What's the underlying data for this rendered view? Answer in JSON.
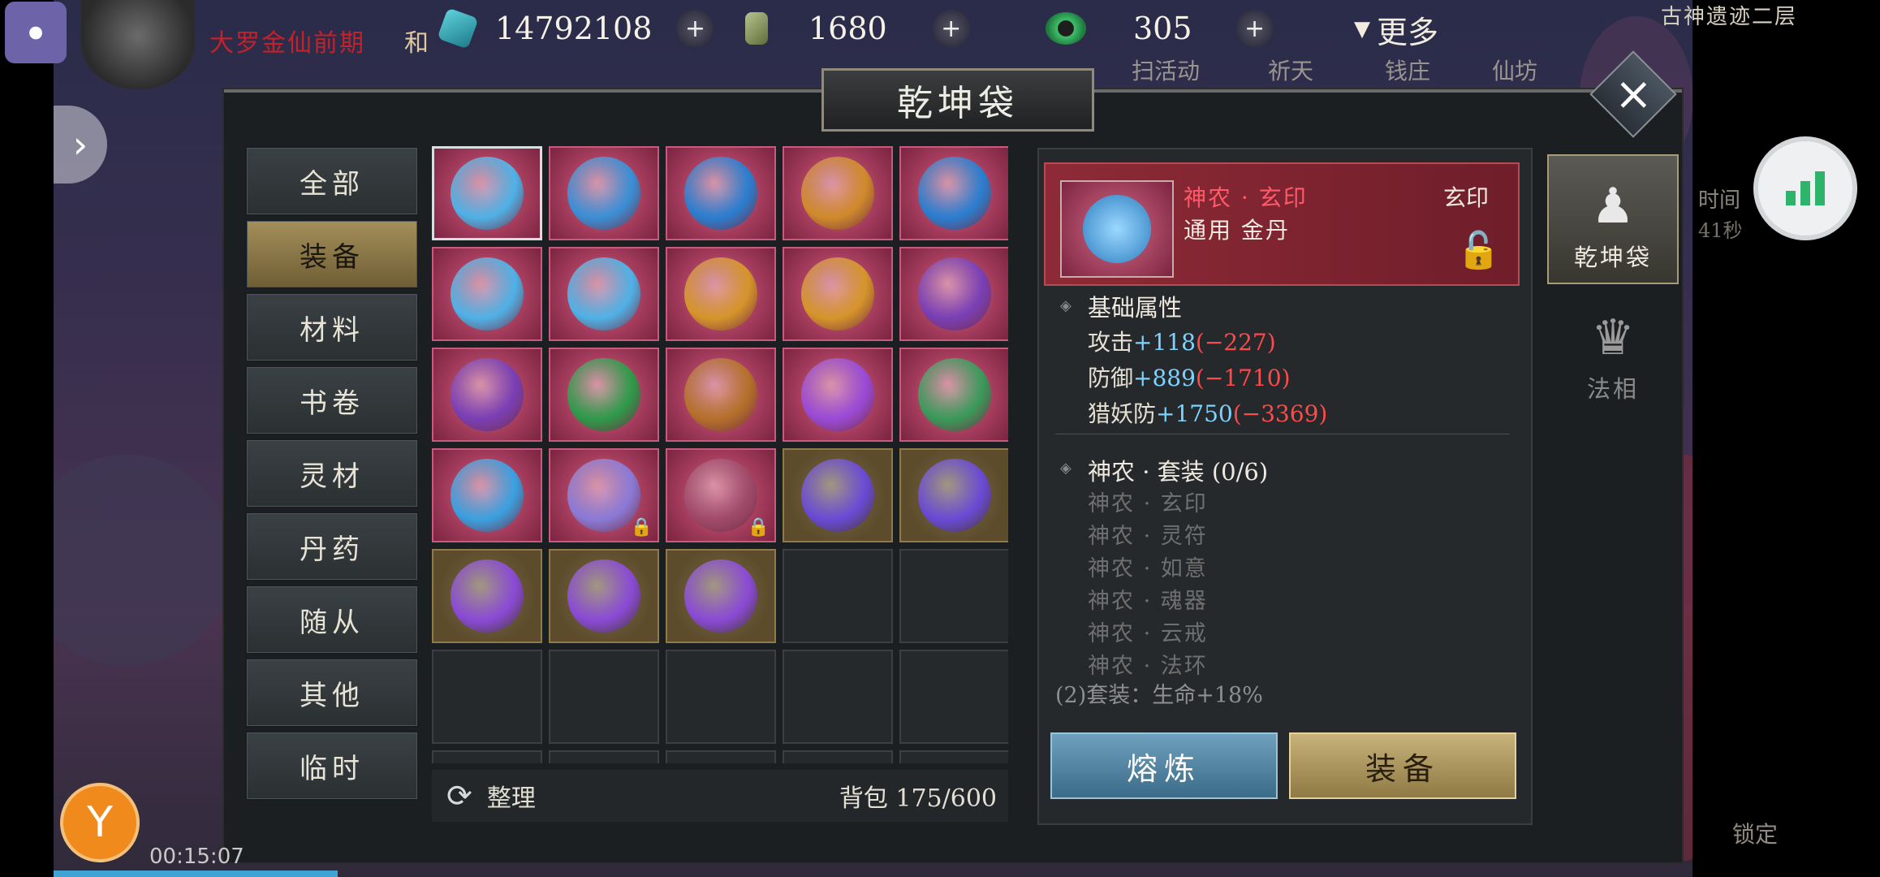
{
  "topbar": {
    "player_name": "大罗金仙前期",
    "player_name_suffix": "和",
    "zone": "古神遗迹二层",
    "resources": [
      {
        "name": "spirit-stone",
        "value": "14792108",
        "color": "#2aa7b5"
      },
      {
        "name": "jade-token",
        "value": "1680",
        "color": "#8c9a66"
      },
      {
        "name": "jade-ring",
        "value": "305",
        "color": "#3aa35f"
      }
    ],
    "more_label": "更多",
    "faint_labels": [
      "扫活动",
      "祈天",
      "钱庄",
      "仙坊"
    ]
  },
  "panel": {
    "title": "乾坤袋",
    "categories": [
      "全部",
      "装备",
      "材料",
      "书卷",
      "灵材",
      "丹药",
      "随从",
      "其他",
      "临时"
    ],
    "active_category": 1,
    "sort_label": "整理",
    "bag_count": "背包 175/600"
  },
  "grid": {
    "rows": [
      [
        {
          "bg": "red",
          "color": "#4fb1e6",
          "sel": true
        },
        {
          "bg": "red",
          "color": "#3a8fd6"
        },
        {
          "bg": "red",
          "color": "#2a7ed0"
        },
        {
          "bg": "red",
          "color": "#d08a2a"
        },
        {
          "bg": "red",
          "color": "#2a7ed0"
        }
      ],
      [
        {
          "bg": "red",
          "color": "#4fb1e6"
        },
        {
          "bg": "red",
          "color": "#4fb1e6"
        },
        {
          "bg": "red",
          "color": "#d6952a"
        },
        {
          "bg": "red",
          "color": "#d6952a"
        },
        {
          "bg": "red",
          "color": "#7a3fb5"
        }
      ],
      [
        {
          "bg": "red",
          "color": "#7a3fb5"
        },
        {
          "bg": "red",
          "color": "#2e9a4a"
        },
        {
          "bg": "red",
          "color": "#b5702a"
        },
        {
          "bg": "red",
          "color": "#9a4ad6"
        },
        {
          "bg": "red",
          "color": "#3a9a5a"
        }
      ],
      [
        {
          "bg": "red",
          "color": "#3aa0e0",
          "lock": false
        },
        {
          "bg": "red",
          "color": "#8a7ad6",
          "lock": true
        },
        {
          "bg": "red",
          "color": "#a04a6a",
          "lock": true
        },
        {
          "bg": "gold",
          "color": "#6a4ad6"
        },
        {
          "bg": "gold",
          "color": "#6a4ad6"
        }
      ],
      [
        {
          "bg": "gold",
          "color": "#8a4ad6"
        },
        {
          "bg": "gold",
          "color": "#8a4ad6"
        },
        {
          "bg": "gold",
          "color": "#8a4ad6"
        },
        {
          "bg": "empty"
        },
        {
          "bg": "empty"
        }
      ],
      [
        {
          "bg": "empty"
        },
        {
          "bg": "empty"
        },
        {
          "bg": "empty"
        },
        {
          "bg": "empty"
        },
        {
          "bg": "empty"
        }
      ],
      [
        {
          "bg": "empty"
        },
        {
          "bg": "empty"
        },
        {
          "bg": "empty"
        },
        {
          "bg": "empty"
        },
        {
          "bg": "empty"
        }
      ]
    ]
  },
  "detail": {
    "name": "神农 · 玄印",
    "type": "玄印",
    "subtitle": "通用 金丹",
    "base_title": "基础属性",
    "stats": [
      {
        "label": "攻击",
        "plus": "+118",
        "minus": "(−227)"
      },
      {
        "label": "防御",
        "plus": "+889",
        "minus": "(−1710)"
      },
      {
        "label": "猎妖防",
        "plus": "+1750",
        "minus": "(−3369)"
      }
    ],
    "set_title": "神农 · 套装 (0/6)",
    "set_items": [
      "神农 · 玄印",
      "神农 · 灵符",
      "神农 · 如意",
      "神农 · 魂器",
      "神农 · 云戒",
      "神农 · 法环"
    ],
    "set_bonus": "(2)套装：生命+18%",
    "smelt_label": "熔炼",
    "equip_label": "装备"
  },
  "side": {
    "bag_label": "乾坤袋",
    "fa_label": "法相"
  },
  "hud": {
    "time_label": "时间",
    "time_value": "41秒",
    "lock_label": "锁定",
    "status_time": "00:15:07"
  }
}
